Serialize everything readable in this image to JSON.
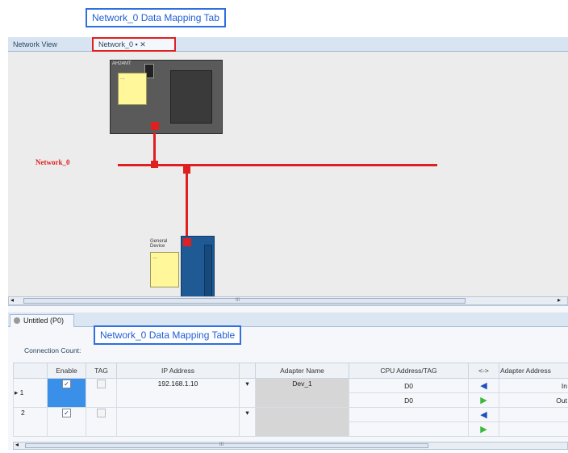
{
  "callouts": {
    "top": "Network_0 Data Mapping Tab",
    "middle": "Network_0 Data Mapping Table"
  },
  "tabs": [
    {
      "label": "Network View"
    },
    {
      "label": "Network_0 ▪ ✕"
    }
  ],
  "canvas": {
    "network_label": "Network_0",
    "device_top": {
      "name": "AH24MT",
      "note": "..."
    },
    "device_bottom": {
      "name": "General Device",
      "note": "..."
    },
    "scroll_mark": "III"
  },
  "panel": {
    "tab_label": "Untitled (P0)",
    "connection_count_label": "Connection Count:"
  },
  "table": {
    "headers": [
      "",
      "Enable",
      "TAG",
      "IP Address",
      "",
      "Adapter Name",
      "CPU Address/TAG",
      "<->",
      "Adapter Address"
    ],
    "rows": [
      {
        "num": "1",
        "ip": "192.168.1.10",
        "adapter": "Dev_1",
        "cpu": "D0",
        "addr": "In"
      },
      {
        "num": "",
        "ip": "",
        "adapter": "",
        "cpu": "D0",
        "addr": "Out"
      },
      {
        "num": "2",
        "ip": "",
        "adapter": "",
        "cpu": "",
        "addr": ""
      },
      {
        "num": "",
        "ip": "",
        "adapter": "",
        "cpu": "",
        "addr": ""
      }
    ]
  },
  "colors": {
    "network": "#e02020",
    "callout": "#2f6fe0",
    "arrow_in": "#1f4fbf",
    "arrow_out": "#3cb83c"
  }
}
